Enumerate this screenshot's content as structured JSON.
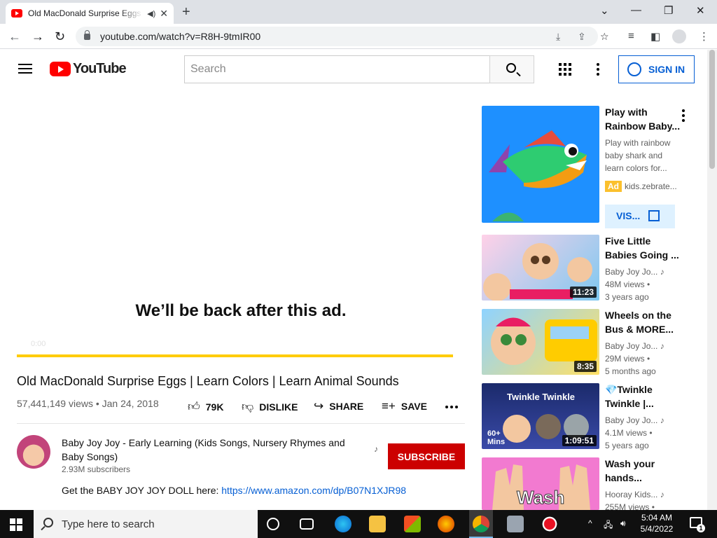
{
  "browser": {
    "tab_title": "Old MacDonald Surprise Eggs | Learn Colors",
    "url": "youtube.com/watch?v=R8H-9tmIR00"
  },
  "header": {
    "logo_text": "YouTube",
    "search_placeholder": "Search",
    "sign_in_label": "SIGN IN"
  },
  "player": {
    "ad_message": "We’ll be back after this ad.",
    "ad_countdown": "0:00",
    "ad_progress": 1.0
  },
  "video": {
    "title": "Old MacDonald Surprise Eggs | Learn Colors | Learn Animal Sounds",
    "views_date": "57,441,149 views • Jan 24, 2018",
    "likes": "79K",
    "dislike_label": "DISLIKE",
    "share_label": "SHARE",
    "save_label": "SAVE",
    "channel_name": "Baby Joy Joy - Early Learning (Kids Songs, Nursery Rhymes and Baby Songs)",
    "subscribers": "2.93M subscribers",
    "subscribe_label": "SUBSCRIBE",
    "description_text": "Get the BABY JOY JOY DOLL here: ",
    "description_link": "https://www.amazon.com/dp/B07N1XJR98"
  },
  "sidebar": {
    "ad": {
      "title_line1": "Play with",
      "title_line2": "Rainbow Baby...",
      "desc_line1": "Play with rainbow",
      "desc_line2": "baby shark and",
      "desc_line3": "learn colors for...",
      "badge": "Ad",
      "domain": "kids.zebrate...",
      "visit_label": "VIS..."
    },
    "items": [
      {
        "title1": "Five Little",
        "title2": "Babies Going ...",
        "channel": "Baby Joy Jo...",
        "views": "48M views •",
        "age": "3 years ago",
        "duration": "11:23"
      },
      {
        "title1": "Wheels on the",
        "title2": "Bus & MORE...",
        "channel": "Baby Joy Jo...",
        "views": "29M views •",
        "age": "5 months ago",
        "duration": "8:35"
      },
      {
        "title1": "💎Twinkle",
        "title2": "Twinkle |...",
        "channel": "Baby Joy Jo...",
        "views": "4.1M views •",
        "age": "5 years ago",
        "duration": "1:09:51",
        "thumb_text": "Twinkle Twinkle",
        "badge_text": "60+ Mins"
      },
      {
        "title1": "Wash your",
        "title2": "hands...",
        "channel": "Hooray Kids...",
        "views": "255M views •",
        "age": "",
        "duration": "",
        "thumb_text": "Wash"
      }
    ]
  },
  "taskbar": {
    "search_placeholder": "Type here to search",
    "time": "5:04 AM",
    "date": "5/4/2022",
    "notification_count": "1"
  }
}
